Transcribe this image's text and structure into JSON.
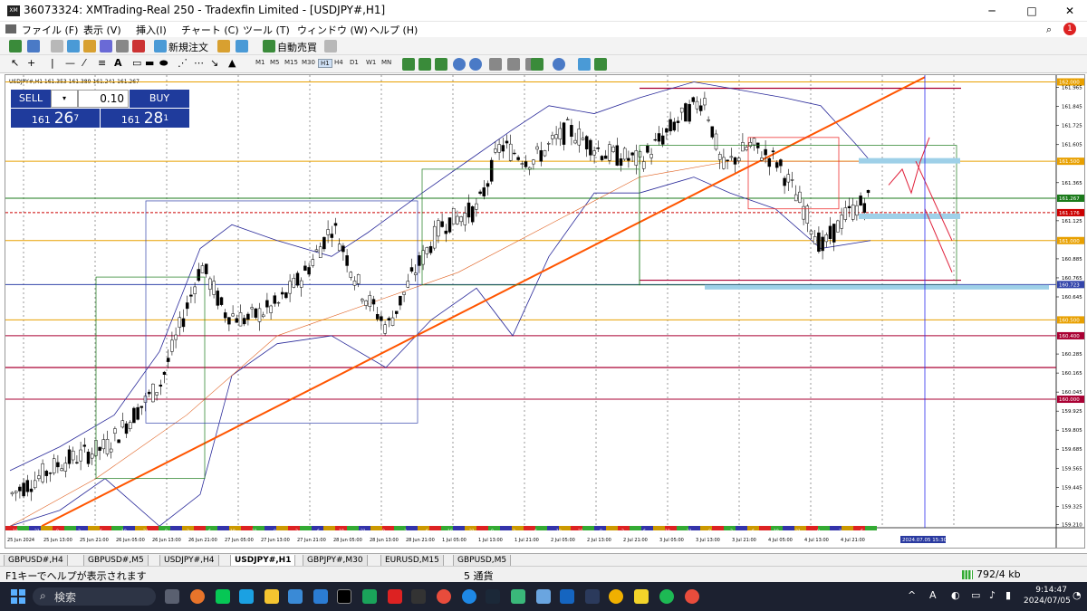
{
  "window": {
    "title": "36073324: XMTrading-Real 250 - Tradexfin Limited - [USDJPY#,H1]",
    "minimize": "─",
    "maximize": "□",
    "close": "✕"
  },
  "menu": [
    "ファイル (F)",
    "表示 (V)",
    "挿入(I)",
    "チャート (C)",
    "ツール (T)",
    "ウィンドウ (W)",
    "ヘルプ (H)"
  ],
  "toolbar": {
    "new_order": "新規注文",
    "auto_trade": "自動売買",
    "timeframes": [
      "M1",
      "M5",
      "M15",
      "M30",
      "H1",
      "H4",
      "D1",
      "W1",
      "MN"
    ],
    "active_timeframe": "H1"
  },
  "chart": {
    "info": "USDJPY#,H1  161.353 161.389 161.241 161.267",
    "lot": "0.10",
    "sell": {
      "label": "SELL",
      "prefix": "161",
      "big": "26",
      "sup": "7"
    },
    "buy": {
      "label": "BUY",
      "prefix": "161",
      "big": "28",
      "sup": "1"
    },
    "price_labels": [
      "161.965",
      "161.845",
      "161.725",
      "161.605",
      "161.365",
      "161.125",
      "160.885",
      "160.765",
      "160.645",
      "160.285",
      "160.165",
      "160.045",
      "159.925",
      "159.805",
      "159.685",
      "159.565",
      "159.445",
      "159.325",
      "159.210"
    ],
    "tagged_levels": [
      {
        "label": "162.000",
        "color": "#e8a000"
      },
      {
        "label": "161.500",
        "color": "#e8a000"
      },
      {
        "label": "161.267",
        "color": "#1a7a1a"
      },
      {
        "label": "161.176",
        "color": "#cc0000"
      },
      {
        "label": "161.000",
        "color": "#e8a000"
      },
      {
        "label": "160.723",
        "color": "#3344aa"
      },
      {
        "label": "160.500",
        "color": "#e8a000"
      },
      {
        "label": "160.400",
        "color": "#aa0033"
      },
      {
        "label": "160.000",
        "color": "#aa0033"
      }
    ],
    "time_labels": [
      "25 Jun 2024",
      "25 Jun 13:00",
      "25 Jun 21:00",
      "26 Jun 05:00",
      "26 Jun 13:00",
      "26 Jun 21:00",
      "27 Jun 05:00",
      "27 Jun 13:00",
      "27 Jun 21:00",
      "28 Jun 05:00",
      "28 Jun 13:00",
      "28 Jun 21:00",
      "1 Jul 05:00",
      "1 Jul 13:00",
      "1 Jul 21:00",
      "2 Jul 05:00",
      "2 Jul 13:00",
      "2 Jul 21:00",
      "3 Jul 05:00",
      "3 Jul 13:00",
      "3 Jul 21:00",
      "4 Jul 05:00",
      "4 Jul 13:00",
      "4 Jul 21:00"
    ],
    "cursor_time": "2024.07.05 15:30",
    "session_marks": [
      "18",
      "21",
      "0",
      "3",
      "6"
    ]
  },
  "tabs": [
    "GBPUSD#,H4",
    "GBPUSD#,M5",
    "USDJPY#,H4",
    "USDJPY#,H1",
    "GBPJPY#,M30",
    "EURUSD,M15",
    "GBPUSD,M5"
  ],
  "active_tab": "USDJPY#,H1",
  "status": {
    "help": "F1キーでヘルプが表示されます",
    "messages": "5 通貨",
    "traffic": "792/4 kb"
  },
  "taskbar": {
    "search": "検索",
    "time": "9:14:47",
    "date": "2024/07/05",
    "ime": "A"
  }
}
